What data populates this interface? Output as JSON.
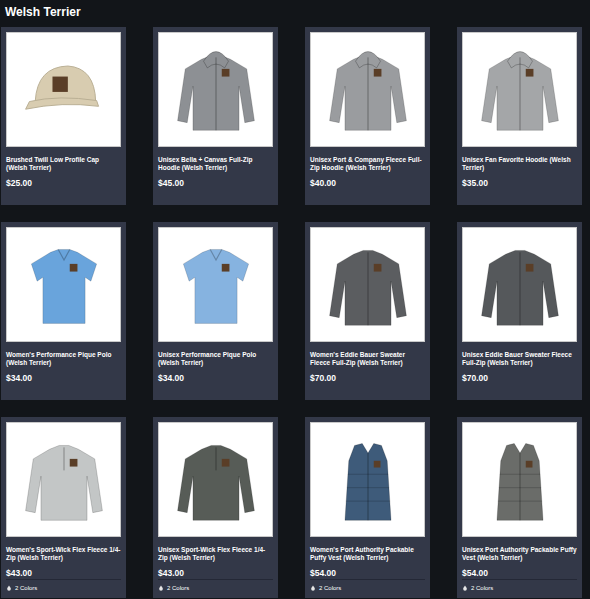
{
  "page": {
    "title": "Welsh Terrier"
  },
  "products": [
    {
      "name": "Brushed Twill Low Profile Cap (Welsh Terrier)",
      "price": "$25.00",
      "kind": "cap",
      "color": "#d8ccb0"
    },
    {
      "name": "Unisex Bella + Canvas Full-Zip Hoodie (Welsh Terrier)",
      "price": "$45.00",
      "kind": "hoodie",
      "color": "#8d9094"
    },
    {
      "name": "Unisex Port & Company Fleece Full-Zip Hoodie (Welsh Terrier)",
      "price": "$40.00",
      "kind": "hoodie",
      "color": "#9a9c9f"
    },
    {
      "name": "Unisex Fan Favorite Hoodie (Welsh Terrier)",
      "price": "$35.00",
      "kind": "hoodie",
      "color": "#a4a6a8"
    },
    {
      "name": "Women's Performance Pique Polo (Welsh Terrier)",
      "price": "$34.00",
      "kind": "polo",
      "color": "#69a4dc"
    },
    {
      "name": "Unisex Performance Pique Polo (Welsh Terrier)",
      "price": "$34.00",
      "kind": "polo",
      "color": "#86b3e0"
    },
    {
      "name": "Women's Eddie Bauer Sweater Fleece Full-Zip (Welsh Terrier)",
      "price": "$70.00",
      "kind": "jacket",
      "color": "#5b5d60"
    },
    {
      "name": "Unisex Eddie Bauer Sweater Fleece Full-Zip (Welsh Terrier)",
      "price": "$70.00",
      "kind": "jacket",
      "color": "#55585b"
    },
    {
      "name": "Women's Sport-Wick Flex Fleece 1/4-Zip (Welsh Terrier)",
      "price": "$43.00",
      "kind": "quarter-zip",
      "color": "#c3c6c6",
      "colors": "2 Colors"
    },
    {
      "name": "Unisex Sport-Wick Flex Fleece 1/4-Zip (Welsh Terrier)",
      "price": "$43.00",
      "kind": "quarter-zip",
      "color": "#575c57",
      "colors": "2 Colors"
    },
    {
      "name": "Women's Port Authority Packable Puffy Vest (Welsh Terrier)",
      "price": "$54.00",
      "kind": "vest",
      "color": "#3e5b7a",
      "colors": "2 Colors"
    },
    {
      "name": "Unisex Port Authority Packable Puffy Vest (Welsh Terrier)",
      "price": "$54.00",
      "kind": "vest",
      "color": "#6a6c69",
      "colors": "2 Colors"
    }
  ]
}
